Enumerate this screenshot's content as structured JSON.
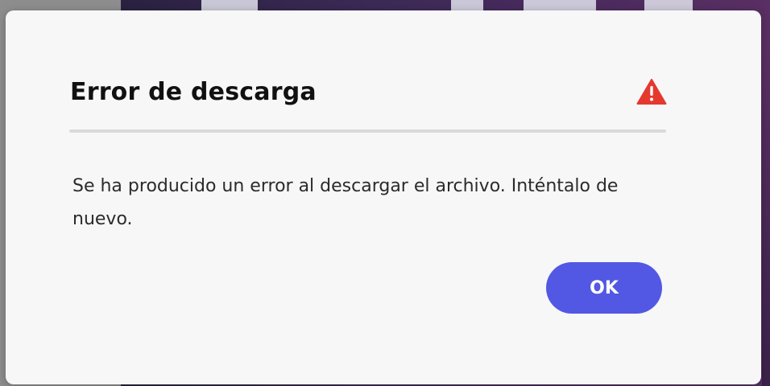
{
  "dialog": {
    "title": "Error de descarga",
    "icon": "alert-triangle-icon",
    "message": "Se ha producido un error al descargar el archivo. Inténtalo de nuevo.",
    "ok_label": "OK"
  },
  "colors": {
    "accent": "#5258e4",
    "alert": "#e5382f",
    "divider": "#dadada",
    "dialog_bg": "#f7f7f8"
  }
}
